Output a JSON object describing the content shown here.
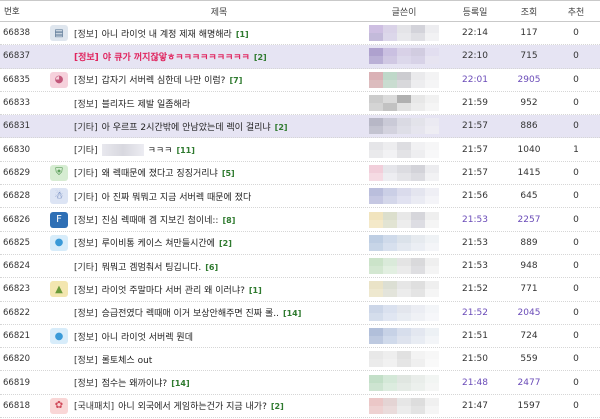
{
  "header": {
    "num": "번호",
    "subject": "제목",
    "author": "글쓴이",
    "date": "등록일",
    "views": "조회",
    "recommend": "추천"
  },
  "posts": [
    {
      "num": "66838",
      "icon": "board-icon",
      "category": "[정보]",
      "title": "아니 라이엇 내 계정 제재 해명해라",
      "comments": "[1]",
      "date": "22:14",
      "views": "117",
      "rec": "0",
      "highlight": false,
      "red": false,
      "purple": false,
      "mosaic": [
        "#c9b9df",
        "#d6cfe6",
        "#e2e2e6",
        "#cfcfd6",
        "#ececef",
        "#bdb3d6",
        "#d9d3e8",
        "#e6e6ea",
        "#dcdce2",
        "#f1f1f3"
      ]
    },
    {
      "num": "66837",
      "icon": "",
      "category": "[정보]",
      "title": "야 큐가 꺼지잖앟ㅎㅋㅋㅋㅋㅋㅋㅋㅋㅋ",
      "comments": "[2]",
      "date": "22:10",
      "views": "715",
      "rec": "0",
      "highlight": true,
      "red": true,
      "purple": false,
      "mosaic": [
        "#a99aca",
        "#c7bde0",
        "#d7d0e6",
        "#cfcadf",
        "#e2def0",
        "#b6abd3",
        "#cec6e2",
        "#dcd7eb",
        "#d6d1e6",
        "#e8e5f1"
      ]
    },
    {
      "num": "66835",
      "icon": "pig-icon",
      "category": "[정보]",
      "title": "갑자기 서버렉 심한데 나만 이럼?",
      "comments": "[7]",
      "date": "22:01",
      "views": "2905",
      "rec": "0",
      "highlight": false,
      "red": false,
      "purple": true,
      "mosaic": [
        "#d7a9ad",
        "#b9d4c4",
        "#c7c7cc",
        "#e8e8ea",
        "#f2f2f3",
        "#d9b5b8",
        "#c4d9cb",
        "#d4d4d8",
        "#ececee",
        "#f5f5f6"
      ]
    },
    {
      "num": "66833",
      "icon": "",
      "category": "[정보]",
      "title": "블리자드 제발 일좀해라",
      "comments": "",
      "date": "21:59",
      "views": "952",
      "rec": "0",
      "highlight": false,
      "red": false,
      "purple": false,
      "mosaic": [
        "#c7c7c7",
        "#d8d8d8",
        "#a8a8a8",
        "#e5e5e5",
        "#f0f0f0",
        "#d0d0d0",
        "#bcbcbc",
        "#dedede",
        "#ebebeb",
        "#f4f4f4"
      ]
    },
    {
      "num": "66831",
      "icon": "",
      "category": "[기타]",
      "title": "아 우르프 2시간밖에 안남았는데 렉이 걸리냐",
      "comments": "[2]",
      "date": "21:57",
      "views": "886",
      "rec": "0",
      "highlight": true,
      "red": false,
      "purple": false,
      "mosaic": [
        "#b3b3c2",
        "#c8c8d4",
        "#d9d9e2",
        "#e3e3ea",
        "#ecebf2",
        "#bfbfcc",
        "#d1d1dc",
        "#dedee6",
        "#e6e6ee",
        "#efeff4"
      ]
    },
    {
      "num": "66830",
      "icon": "",
      "category": "[기타]",
      "title": "ㅋㅋㅋ",
      "comments": "[11]",
      "date": "21:57",
      "views": "1040",
      "rec": "1",
      "highlight": false,
      "red": false,
      "purple": false,
      "blurPrefix": true,
      "mosaic": [
        "#e3e3e6",
        "#ececee",
        "#dadade",
        "#f0f0f2",
        "#f6f6f7",
        "#e8e8ea",
        "#f1f1f3",
        "#e1e1e4",
        "#ededef",
        "#f8f8f9"
      ]
    },
    {
      "num": "66829",
      "icon": "shield-icon",
      "category": "[기타]",
      "title": "왜 렉때문에 졌다고 징징거리냐",
      "comments": "[5]",
      "date": "21:57",
      "views": "1415",
      "rec": "0",
      "highlight": false,
      "red": false,
      "purple": false,
      "mosaic": [
        "#f0c9d6",
        "#e3e3e8",
        "#d9d9de",
        "#cfcfd5",
        "#ebebee",
        "#f4d6e0",
        "#ececf0",
        "#e2e2e6",
        "#d9d9de",
        "#f1f1f3"
      ]
    },
    {
      "num": "66828",
      "icon": "character-icon",
      "category": "[기타]",
      "title": "아 진짜 뭐뭐고 지금 서버렉 때문에 졌다",
      "comments": "",
      "date": "21:56",
      "views": "645",
      "rec": "0",
      "highlight": false,
      "red": false,
      "purple": false,
      "mosaic": [
        "#b3b7d9",
        "#c6cae4",
        "#d6d8ea",
        "#e2e3ee",
        "#eeeef5",
        "#bfc2df",
        "#d0d3e8",
        "#dedff0",
        "#e8e9f2",
        "#f3f3f8"
      ]
    },
    {
      "num": "66826",
      "icon": "f-logo-icon",
      "category": "[정보]",
      "title": "진심 렉때매 겜 지보긴 첨이네::",
      "comments": "[8]",
      "date": "21:53",
      "views": "2257",
      "rec": "0",
      "highlight": false,
      "red": false,
      "purple": true,
      "mosaic": [
        "#f0e2b8",
        "#d9dcc8",
        "#e6e6e6",
        "#d2d2d8",
        "#eeeeee",
        "#f3e7c4",
        "#dfe2cf",
        "#ececec",
        "#dadae0",
        "#f4f4f4"
      ]
    },
    {
      "num": "66825",
      "icon": "bubble-icon",
      "category": "[정보]",
      "title": "루이비통 케이스 쳐만들시간에",
      "comments": "[2]",
      "date": "21:53",
      "views": "889",
      "rec": "0",
      "highlight": false,
      "red": false,
      "purple": false,
      "mosaic": [
        "#b7c9e0",
        "#cad7e8",
        "#d8dfe8",
        "#e4e8ee",
        "#eef1f5",
        "#c2d1e5",
        "#d3dded",
        "#e0e6ef",
        "#e9edf3",
        "#f3f5f8"
      ]
    },
    {
      "num": "66824",
      "icon": "",
      "category": "[기타]",
      "title": "뭐뭐고 겜멈춰서 팅깁니다.",
      "comments": "[6]",
      "date": "21:53",
      "views": "948",
      "rec": "0",
      "highlight": false,
      "red": false,
      "purple": false,
      "mosaic": [
        "#c6e0c4",
        "#d7e8d6",
        "#e2e2e2",
        "#d5d5d8",
        "#eeeeee",
        "#cfe5cd",
        "#dfeede",
        "#e9e9e9",
        "#dbdbde",
        "#f3f3f3"
      ]
    },
    {
      "num": "66823",
      "icon": "landscape-icon",
      "category": "[정보]",
      "title": "라이엇 주말마다 서버 관리 왜 이러냐?",
      "comments": "[1]",
      "date": "21:52",
      "views": "771",
      "rec": "0",
      "highlight": false,
      "red": false,
      "purple": false,
      "mosaic": [
        "#e8e0c2",
        "#d9dcd0",
        "#e4e4e4",
        "#dcdcdc",
        "#eeeeee",
        "#ede6ca",
        "#e0e2d8",
        "#eaeaea",
        "#e2e2e2",
        "#f4f4f4"
      ]
    },
    {
      "num": "66822",
      "icon": "",
      "category": "[정보]",
      "title": "승급전였다 렉때매 이거 보상안해주면 진짜 롤..",
      "comments": "[14]",
      "date": "21:52",
      "views": "2045",
      "rec": "0",
      "highlight": false,
      "red": false,
      "purple": true,
      "mosaic": [
        "#c7d2e6",
        "#d6deee",
        "#e0e4ec",
        "#e9ecf2",
        "#f2f4f8",
        "#d0daeb",
        "#dde4f1",
        "#e6eaf1",
        "#eef0f5",
        "#f6f7fa"
      ]
    },
    {
      "num": "66821",
      "icon": "bubble-icon",
      "category": "[정보]",
      "title": "아니 라이엇 서버렉 뭔데",
      "comments": "",
      "date": "21:51",
      "views": "724",
      "rec": "0",
      "highlight": false,
      "red": false,
      "purple": false,
      "mosaic": [
        "#a9b9d6",
        "#c2cee4",
        "#d3dbea",
        "#e0e5ef",
        "#ecf0f5",
        "#b6c4dd",
        "#ccd6e9",
        "#dbe1ed",
        "#e6eaf2",
        "#f2f4f8"
      ]
    },
    {
      "num": "66820",
      "icon": "",
      "category": "[정보]",
      "title": "롤토체스 out",
      "comments": "",
      "date": "21:50",
      "views": "559",
      "rec": "0",
      "highlight": false,
      "red": false,
      "purple": false,
      "mosaic": [
        "#e6e6e6",
        "#ededed",
        "#dedede",
        "#f2f2f2",
        "#f7f7f7",
        "#e9e9e9",
        "#f0f0f0",
        "#e3e3e3",
        "#eeeeee",
        "#f9f9f9"
      ]
    },
    {
      "num": "66819",
      "icon": "",
      "category": "[정보]",
      "title": "점수는 왜까이냐?",
      "comments": "[14]",
      "date": "21:48",
      "views": "2477",
      "rec": "0",
      "highlight": false,
      "red": false,
      "purple": true,
      "mosaic": [
        "#bcdcc2",
        "#d0e6d4",
        "#dde4de",
        "#e7ece8",
        "#f1f4f2",
        "#c8e2cd",
        "#d9ebdc",
        "#e3e9e4",
        "#ebefec",
        "#f4f6f4"
      ]
    },
    {
      "num": "66818",
      "icon": "flower-icon",
      "category": "[국내패치]",
      "title": "아니 외국에서 게임하는건가 지금 내가?",
      "comments": "[2]",
      "date": "21:47",
      "views": "1597",
      "rec": "0",
      "highlight": false,
      "red": false,
      "purple": false,
      "mosaic": [
        "#e9c1c1",
        "#e2d0d0",
        "#e4e4e4",
        "#dadada",
        "#efefef",
        "#edcdcd",
        "#e8d8d8",
        "#ebebeb",
        "#e1e1e1",
        "#f4f4f4"
      ]
    }
  ],
  "colors": {
    "highlight_row": "#e6e4f3",
    "hot_red": "#e0245e",
    "hot_views_purple": "#6a4bb8",
    "comment_green": "#2f7a2f"
  }
}
